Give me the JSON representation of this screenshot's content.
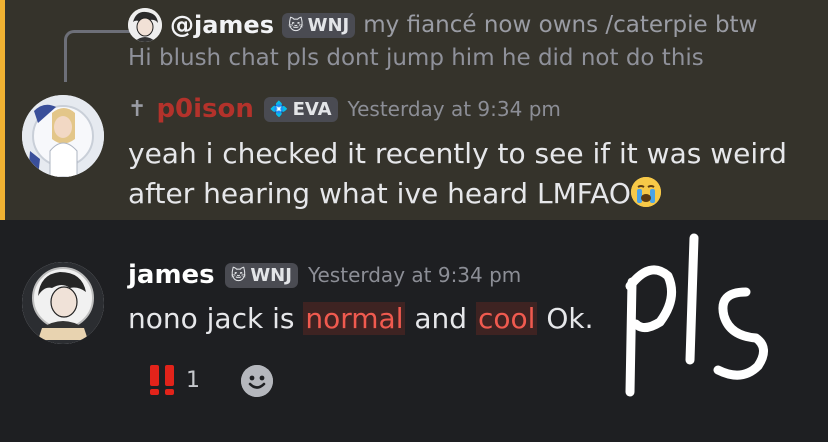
{
  "reply": {
    "author": "@james",
    "tag": {
      "emoji": "🐱",
      "label": "WNJ"
    },
    "preview": "my fiancé now owns /caterpie btw",
    "second_line": "Hi blush chat pls dont jump him he did not do this"
  },
  "message1": {
    "prefix_icon": "✝",
    "username": "p0ison",
    "username_color": "#b3322b",
    "tag": {
      "emoji": "💠",
      "label": "EVA"
    },
    "timestamp": "Yesterday at 9:34 pm",
    "lines": [
      "yeah i checked it recently to see if it was weird",
      "after hearing what ive heard LMFAO"
    ],
    "emoji": "crying-face-emoji"
  },
  "message2": {
    "username": "james",
    "tag": {
      "emoji": "🐱",
      "label": "WNJ"
    },
    "timestamp": "Yesterday at 9:34 pm",
    "text_before": "nono jack is",
    "highlight1": "normal",
    "text_middle": "and",
    "highlight2": "cool",
    "text_after": "Ok."
  },
  "reaction": {
    "emoji": "‼️",
    "count": "1"
  },
  "colors": {
    "mention_highlight_bg": "#35332b",
    "mention_bar": "#f0b232",
    "background": "#1e1f22"
  }
}
